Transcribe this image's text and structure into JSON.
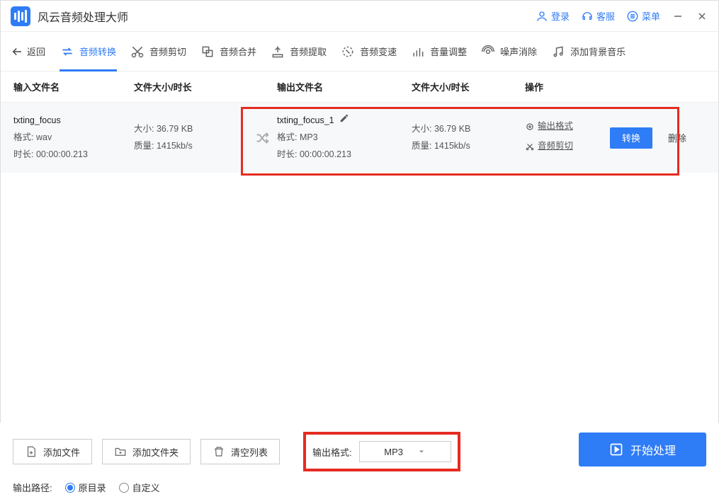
{
  "titlebar": {
    "app_title": "风云音频处理大师",
    "login": "登录",
    "support": "客服",
    "menu": "菜单"
  },
  "toolbar": {
    "back": "返回",
    "tabs": [
      {
        "label": "音频转换",
        "icon": "swap"
      },
      {
        "label": "音频剪切",
        "icon": "cut"
      },
      {
        "label": "音频合并",
        "icon": "merge"
      },
      {
        "label": "音频提取",
        "icon": "extract"
      },
      {
        "label": "音频变速",
        "icon": "speed"
      },
      {
        "label": "音量调整",
        "icon": "volume"
      },
      {
        "label": "噪声消除",
        "icon": "noise"
      },
      {
        "label": "添加背景音乐",
        "icon": "music"
      }
    ]
  },
  "table": {
    "headers": {
      "in_name": "输入文件名",
      "in_size": "文件大小/时长",
      "out_name": "输出文件名",
      "out_size": "文件大小/时长",
      "ops": "操作"
    },
    "row": {
      "in_name": "txting_focus",
      "in_format_label": "格式:",
      "in_format": "wav",
      "in_duration_label": "时长:",
      "in_duration": "00:00:00.213",
      "in_size_label": "大小:",
      "in_size": "36.79 KB",
      "in_quality_label": "质量:",
      "in_quality": "1415kb/s",
      "out_name": "txting_focus_1",
      "out_format_label": "格式:",
      "out_format": "MP3",
      "out_duration_label": "时长:",
      "out_duration": "00:00:00.213",
      "out_size_label": "大小:",
      "out_size": "36.79 KB",
      "out_quality_label": "质量:",
      "out_quality": "1415kb/s",
      "op_format": "输出格式",
      "op_cut": "音频剪切",
      "convert": "转换",
      "delete": "删除"
    }
  },
  "bottom": {
    "add_file": "添加文件",
    "add_folder": "添加文件夹",
    "clear_list": "清空列表",
    "out_format_label": "输出格式:",
    "out_format_value": "MP3",
    "start": "开始处理",
    "out_path_label": "输出路径:",
    "radio_original": "原目录",
    "radio_custom": "自定义"
  }
}
